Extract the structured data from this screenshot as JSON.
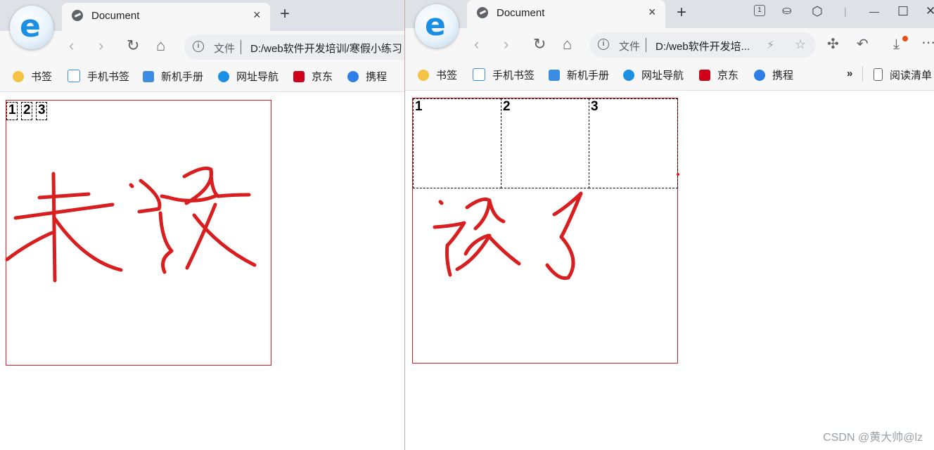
{
  "left": {
    "tab_title": "Document",
    "tab_close": "×",
    "new_tab": "+",
    "address": {
      "label": "文件",
      "url": "D:/web软件开发培训/寒假小练习"
    },
    "bookmarks": [
      "书签",
      "手机书签",
      "新机手册",
      "网址导航",
      "京东",
      "携程"
    ],
    "cells": [
      "1",
      "2",
      "3"
    ],
    "annotation": "未设"
  },
  "right": {
    "tab_title": "Document",
    "tab_close": "×",
    "new_tab": "+",
    "address": {
      "label": "文件",
      "url": "D:/web软件开发培..."
    },
    "bookmarks": [
      "书签",
      "手机书签",
      "新机手册",
      "网址导航",
      "京东",
      "携程"
    ],
    "bookmarks_more": "»",
    "reading_list": "阅读清单",
    "more_menu": "⋯",
    "cells": [
      "1",
      "2",
      "3"
    ],
    "annotation": "设了"
  },
  "nav": {
    "back": "‹",
    "forward": "›",
    "reload": "↻",
    "home": "⌂"
  },
  "window_controls": {
    "minimize": "—",
    "maximize": "☐",
    "close": "✕"
  },
  "watermark": "CSDN @黄大帅@lz",
  "colors": {
    "annotation_red": "#d81e1e",
    "tab_strip": "#dee1e6",
    "toolbar": "#f7f7f7",
    "logo_blue": "#1a8fe3"
  },
  "icons": [
    "browser-logo-icon",
    "document-tab-icon",
    "info-icon",
    "star-icon",
    "bookmark-phone-icon",
    "manual-icon",
    "ie-nav-icon",
    "jd-icon",
    "ctrip-icon",
    "extensions-icon",
    "download-icon",
    "bolt-icon",
    "favorite-icon",
    "undo-icon"
  ]
}
